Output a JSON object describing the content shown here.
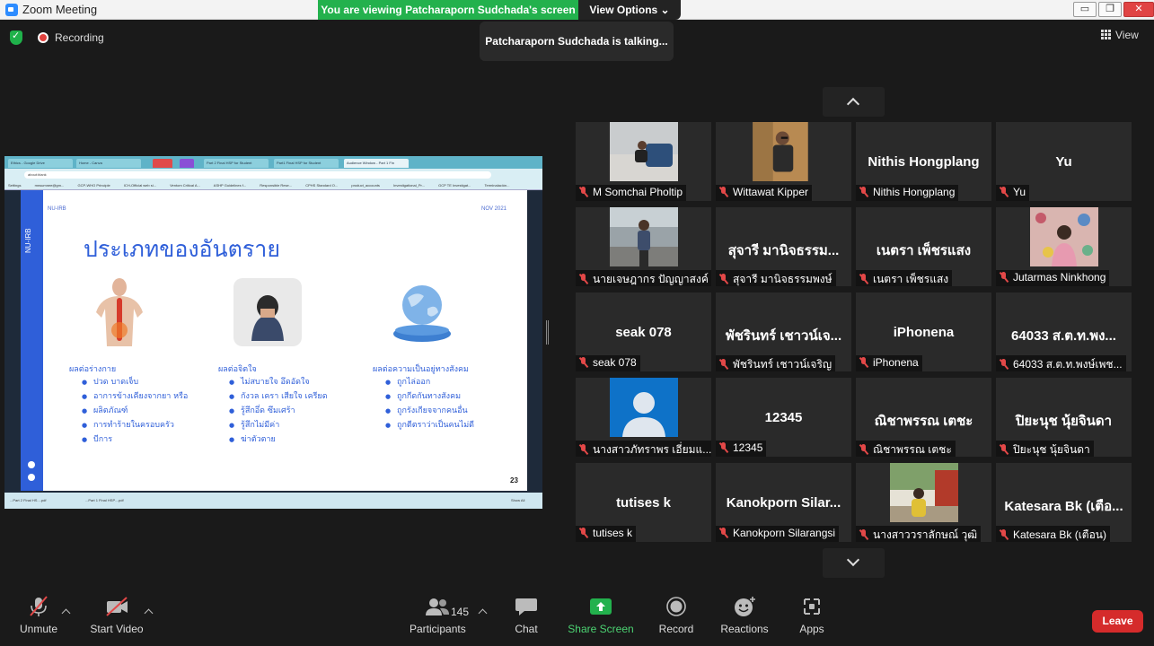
{
  "window": {
    "title": "Zoom Meeting",
    "minimize": "▭",
    "restore": "❐",
    "close": "✕"
  },
  "banner": {
    "viewing": "You are viewing Patcharaporn Sudchada's screen",
    "view_options": "View Options ⌄"
  },
  "status": {
    "recording": "Recording",
    "talking": "Patcharaporn Sudchada is talking...",
    "view": "View"
  },
  "shared_screen": {
    "browser_tabs": [
      "Ethics - Google Drive",
      "Home - Canva",
      "(red)",
      "(purple)",
      "Part 2 Final HSP for Student",
      "Part1 Final HSP for Student",
      "Audience Window - Part 1 Fin"
    ],
    "url": "about:blank",
    "bookmarks": [
      "Settings",
      "mnsumnee@gm...",
      "GCP-WHO Principle",
      "ICH-Official web si...",
      "Ventom Critical A...",
      "ASHP Guidelines f...",
      "Responsible Rese...",
      "CPHS Standard O...",
      "product_accounts",
      "Investigational_Pr...",
      "GCP TE Investigat...",
      "Terminalación..."
    ],
    "downloads": [
      "...Part 2 Final HS....pdf",
      "...Part 1 Final HSP....pdf",
      "Show All"
    ],
    "slide": {
      "side_label": "NU-IRB",
      "header_left": "NU-IRB",
      "header_right": "NOV 2021",
      "title": "ประเภทของอันตราย",
      "page": "23",
      "columns": [
        {
          "heading": "ผลต่อร่างกาย",
          "items": [
            "ปวด บาดเจ็บ",
            "อาการข้างเคียงจากยา หรือ",
            "ผลิตภัณฑ์",
            "การทำร้ายในครอบครัว",
            "บีการ"
          ]
        },
        {
          "heading": "ผลต่อจิตใจ",
          "items": [
            "ไม่สบายใจ อึดอัดใจ",
            "กังวล เครา เสียใจ เครียด",
            "รู้สึกอึ่ด ซึมเศร้า",
            "รู้สึกไม่มีค่า",
            "ฆ่าตัวตาย"
          ]
        },
        {
          "heading": "ผลต่อความเป็นอยู่ทางสังคม",
          "items": [
            "ถูกไล่ออก",
            "ถูกกีดกันทางสังคม",
            "ถูกรังเกียจจากคนอื่น",
            "ถูกตีตราว่าเป็นคนไม่ดี"
          ]
        }
      ]
    }
  },
  "participants": [
    {
      "name": "M Somchai Pholtip",
      "big": "",
      "video": "photo-man-sofa"
    },
    {
      "name": "Wittawat Kipper",
      "big": "",
      "video": "photo-man-tree"
    },
    {
      "name": "Nithis Hongplang",
      "big": "Nithis Hongplang",
      "video": ""
    },
    {
      "name": "Yu",
      "big": "Yu",
      "video": ""
    },
    {
      "name": "นายเจษฎากร ปัญญาสงค์",
      "big": "",
      "video": "photo-man-street"
    },
    {
      "name": "สุจารี มานิจธรรมพงษ์",
      "big": "สุจารี มานิจธรรม...",
      "video": ""
    },
    {
      "name": "เนตรา เพ็ชรแสง",
      "big": "เนตรา เพ็ชรแสง",
      "video": ""
    },
    {
      "name": "Jutarmas Ninkhong",
      "big": "",
      "video": "photo-woman-pattern"
    },
    {
      "name": "seak 078",
      "big": "seak 078",
      "video": ""
    },
    {
      "name": "พัชรินทร์ เชาวน์เจริญ",
      "big": "พัชรินทร์ เชาวน์เจ...",
      "video": ""
    },
    {
      "name": "iPhonena",
      "big": "iPhonena",
      "video": ""
    },
    {
      "name": "64033 ส.ต.ท.พงษ์เพช...",
      "big": "64033 ส.ต.ท.พง...",
      "video": ""
    },
    {
      "name": "นางสาวภัทราพร เอี่ยมแ...",
      "big": "",
      "video": "avatar-default"
    },
    {
      "name": "12345",
      "big": "12345",
      "video": ""
    },
    {
      "name": "ณิชาพรรณ เตชะ",
      "big": "ณิชาพรรณ เตชะ",
      "video": ""
    },
    {
      "name": "ปิยะนุช นุ้ยจินดา",
      "big": "ปิยะนุช นุ้ยจินดา",
      "video": ""
    },
    {
      "name": "tutises k",
      "big": "tutises k",
      "video": ""
    },
    {
      "name": "Kanokporn Silarangsi",
      "big": "Kanokporn Silar...",
      "video": ""
    },
    {
      "name": "นางสาววราลักษณ์ วุฒิ",
      "big": "",
      "video": "photo-woman-outdoor"
    },
    {
      "name": "Katesara Bk (เตือน)",
      "big": "Katesara Bk (เตือ...",
      "video": ""
    }
  ],
  "toolbar": {
    "unmute": "Unmute",
    "start_video": "Start Video",
    "participants": "Participants",
    "participant_count": "145",
    "chat": "Chat",
    "share_screen": "Share Screen",
    "record": "Record",
    "reactions": "Reactions",
    "apps": "Apps",
    "leave": "Leave"
  },
  "colors": {
    "share_green": "#23b14d",
    "leave_red": "#d52b2b",
    "mute_red": "#e34848",
    "slide_blue": "#2f5fd9"
  }
}
